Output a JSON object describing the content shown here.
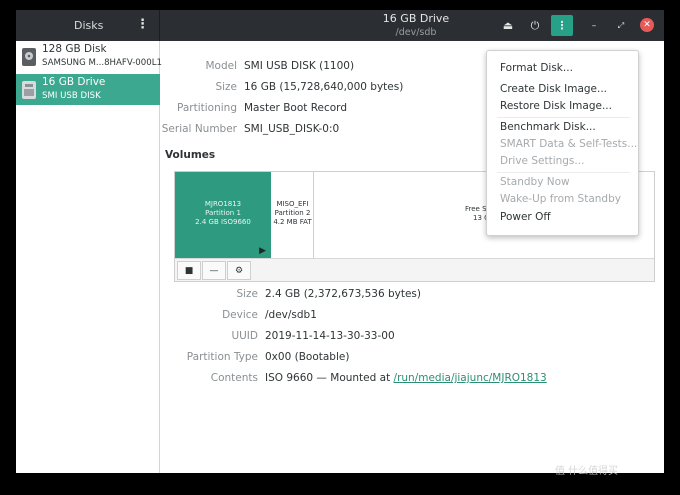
{
  "header": {
    "app_title": "Disks",
    "app_menu_icon": "vertical-dots-icon",
    "drive_title": "16 GB Drive",
    "drive_path": "/dev/sdb",
    "eject_icon": "eject-icon",
    "power_icon": "power-icon",
    "drive_menu_icon": "vertical-dots-icon",
    "minimize_icon": "minimize-icon",
    "maximize_icon": "maximize-icon",
    "close_icon": "close-icon",
    "accent_color": "#26a087"
  },
  "sidebar": {
    "items": [
      {
        "name": "128 GB Disk",
        "sub": "SAMSUNG M...8HAFV-000L1",
        "icon": "hard-disk-icon"
      },
      {
        "name": "16 GB Drive",
        "sub": "SMI USB DISK",
        "icon": "usb-drive-icon"
      }
    ],
    "selected_color": "#3ba88f"
  },
  "drive_info": {
    "model_label": "Model",
    "model_value": "SMI USB DISK (1100)",
    "size_label": "Size",
    "size_value": "16 GB (15,728,640,000 bytes)",
    "partitioning_label": "Partitioning",
    "partitioning_value": "Master Boot Record",
    "serial_label": "Serial Number",
    "serial_value": "SMI_USB_DISK-0:0"
  },
  "volumes": {
    "title": "Volumes",
    "partitions": [
      {
        "line1": "MJRO1813",
        "line2": "Partition 1",
        "line3": "2.4 GB ISO9660"
      },
      {
        "line1": "MISO_EFI",
        "line2": "Partition 2",
        "line3": "4.2 MB FAT"
      },
      {
        "line1": "Free S",
        "line2": "13 G"
      }
    ],
    "toolbar": {
      "stop_icon": "stop-icon",
      "remove_icon": "minus-icon",
      "settings_icon": "gears-icon"
    }
  },
  "volume_info": {
    "size_label": "Size",
    "size_value": "2.4 GB (2,372,673,536 bytes)",
    "device_label": "Device",
    "device_value": "/dev/sdb1",
    "uuid_label": "UUID",
    "uuid_value": "2019-11-14-13-30-33-00",
    "ptype_label": "Partition Type",
    "ptype_value": "0x00 (Bootable)",
    "contents_label": "Contents",
    "contents_prefix": "ISO 9660 — Mounted at ",
    "contents_link": "/run/media/jiajunc/MJRO1813"
  },
  "drive_menu": {
    "items": [
      {
        "label": "Format Disk...",
        "enabled": true
      },
      {
        "label": "Create Disk Image...",
        "enabled": true
      },
      {
        "label": "Restore Disk Image...",
        "enabled": true
      },
      {
        "label": "Benchmark Disk...",
        "enabled": true
      },
      {
        "label": "SMART Data & Self-Tests...",
        "enabled": false
      },
      {
        "label": "Drive Settings...",
        "enabled": false
      },
      {
        "label": "Standby Now",
        "enabled": false
      },
      {
        "label": "Wake-Up from Standby",
        "enabled": false
      },
      {
        "label": "Power Off",
        "enabled": true
      }
    ]
  },
  "watermark": "值 什么值得买"
}
